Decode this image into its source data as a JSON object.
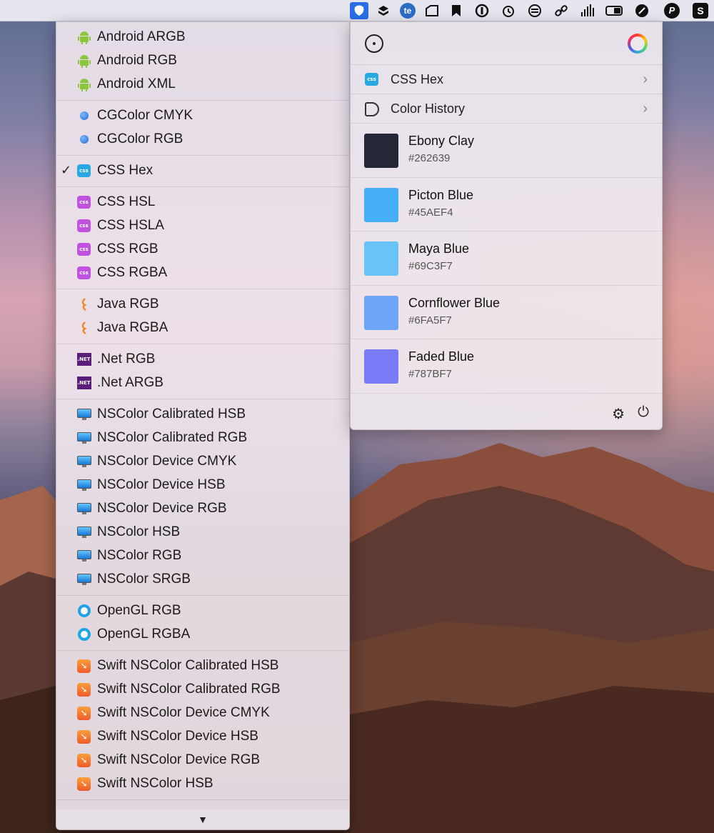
{
  "menubar": {
    "icons": [
      "app-active-icon",
      "dropbox-icon",
      "te-icon",
      "scanner-icon",
      "bookmark-icon",
      "info-icon",
      "alarm-icon",
      "s-circle-icon",
      "link-icon",
      "signal-icon",
      "battery-icon",
      "rocket-icon",
      "p-icon",
      "s-box-icon"
    ]
  },
  "menu": {
    "groups": [
      {
        "items": [
          {
            "label": "Android ARGB",
            "icon": "android-icon"
          },
          {
            "label": "Android RGB",
            "icon": "android-icon"
          },
          {
            "label": "Android XML",
            "icon": "android-icon"
          }
        ]
      },
      {
        "items": [
          {
            "label": "CGColor CMYK",
            "icon": "dot-icon"
          },
          {
            "label": "CGColor RGB",
            "icon": "dot-icon"
          }
        ]
      },
      {
        "items": [
          {
            "label": "CSS Hex",
            "icon": "css-icon",
            "checked": true
          }
        ]
      },
      {
        "items": [
          {
            "label": "CSS HSL",
            "icon": "css-icon"
          },
          {
            "label": "CSS HSLA",
            "icon": "css-icon"
          },
          {
            "label": "CSS RGB",
            "icon": "css-icon"
          },
          {
            "label": "CSS RGBA",
            "icon": "css-icon"
          }
        ]
      },
      {
        "items": [
          {
            "label": "Java RGB",
            "icon": "java-icon"
          },
          {
            "label": "Java RGBA",
            "icon": "java-icon"
          }
        ]
      },
      {
        "items": [
          {
            "label": ".Net RGB",
            "icon": "net-icon"
          },
          {
            "label": ".Net ARGB",
            "icon": "net-icon"
          }
        ]
      },
      {
        "items": [
          {
            "label": "NSColor Calibrated HSB",
            "icon": "monitor-icon"
          },
          {
            "label": "NSColor Calibrated RGB",
            "icon": "monitor-icon"
          },
          {
            "label": "NSColor Device CMYK",
            "icon": "monitor-icon"
          },
          {
            "label": "NSColor Device HSB",
            "icon": "monitor-icon"
          },
          {
            "label": "NSColor Device RGB",
            "icon": "monitor-icon"
          },
          {
            "label": "NSColor HSB",
            "icon": "monitor-icon"
          },
          {
            "label": "NSColor RGB",
            "icon": "monitor-icon"
          },
          {
            "label": "NSColor SRGB",
            "icon": "monitor-icon"
          }
        ]
      },
      {
        "items": [
          {
            "label": "OpenGL RGB",
            "icon": "opengl-icon"
          },
          {
            "label": "OpenGL RGBA",
            "icon": "opengl-icon"
          }
        ]
      },
      {
        "items": [
          {
            "label": "Swift NSColor Calibrated HSB",
            "icon": "swift-icon"
          },
          {
            "label": "Swift NSColor Calibrated RGB",
            "icon": "swift-icon"
          },
          {
            "label": "Swift NSColor Device CMYK",
            "icon": "swift-icon"
          },
          {
            "label": "Swift NSColor Device HSB",
            "icon": "swift-icon"
          },
          {
            "label": "Swift NSColor Device RGB",
            "icon": "swift-icon"
          },
          {
            "label": "Swift NSColor HSB",
            "icon": "swift-icon"
          }
        ]
      }
    ],
    "checkmark": "✓",
    "scroll_arrow": "▼",
    "css_badge_text": "css",
    "net_badge_text": ".NET"
  },
  "panel": {
    "format_row": {
      "label": "CSS Hex",
      "chevron": "›"
    },
    "history_row": {
      "label": "Color History",
      "chevron": "›"
    },
    "colors": [
      {
        "name": "Ebony Clay",
        "hex": "#262639"
      },
      {
        "name": "Picton Blue",
        "hex": "#45AEF4"
      },
      {
        "name": "Maya Blue",
        "hex": "#69C3F7"
      },
      {
        "name": "Cornflower Blue",
        "hex": "#6FA5F7"
      },
      {
        "name": "Faded Blue",
        "hex": "#787BF7"
      }
    ],
    "gear_glyph": "⚙",
    "power_glyph": "⏻"
  },
  "colors": {
    "android": "#8cc63f",
    "css_blue": "#29a9e1",
    "css_purple": "#c052e0",
    "java": "#f0892e",
    "menubar_active": "#2a6ee8"
  }
}
